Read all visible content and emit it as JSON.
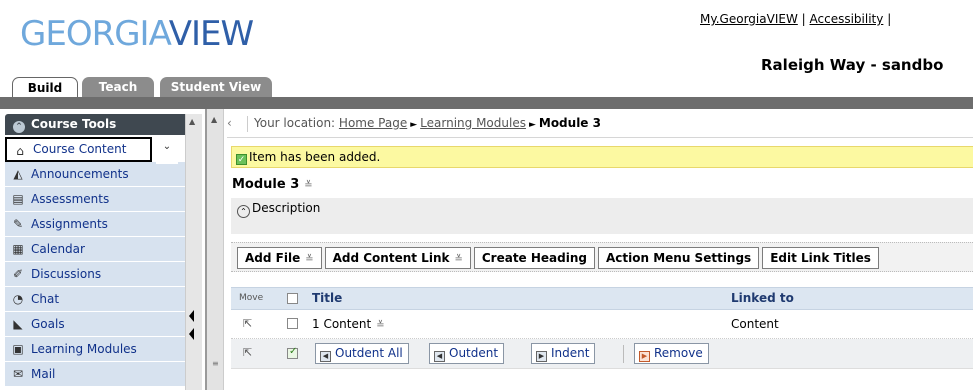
{
  "header": {
    "logo": {
      "part1": "GEORGIA",
      "part2": "VIEW"
    },
    "links": [
      "My.GeorgiaVIEW",
      "Accessibility"
    ],
    "link_separator": "|",
    "course_title": "Raleigh Way - sandbo",
    "tabs": [
      "Build",
      "Teach",
      "Student View"
    ]
  },
  "course_tools": {
    "title": "Course Tools",
    "items": [
      {
        "label": "Course Content",
        "icon": "house-icon",
        "active": true
      },
      {
        "label": "Announcements",
        "icon": "megaphone-icon"
      },
      {
        "label": "Assessments",
        "icon": "assessment-icon"
      },
      {
        "label": "Assignments",
        "icon": "assignment-icon"
      },
      {
        "label": "Calendar",
        "icon": "calendar-icon"
      },
      {
        "label": "Discussions",
        "icon": "discussion-icon"
      },
      {
        "label": "Chat",
        "icon": "chat-bubble-icon"
      },
      {
        "label": "Goals",
        "icon": "goals-icon"
      },
      {
        "label": "Learning Modules",
        "icon": "module-icon"
      },
      {
        "label": "Mail",
        "icon": "mail-icon"
      }
    ]
  },
  "breadcrumb": {
    "prefix": "Your location:",
    "items": [
      "Home Page",
      "Learning Modules"
    ],
    "current": "Module 3"
  },
  "notice": "Item has been added.",
  "module": {
    "title": "Module 3",
    "description_label": "Description"
  },
  "toolbar": {
    "buttons": [
      "Add File",
      "Add Content Link",
      "Create Heading",
      "Action Menu Settings",
      "Edit Link Titles"
    ]
  },
  "grid": {
    "columns": {
      "move": "Move",
      "title": "Title",
      "linked_to": "Linked to"
    },
    "rows": [
      {
        "title": "1 Content",
        "linked_to": "Content",
        "checked": false
      }
    ],
    "actions": [
      "Outdent All",
      "Outdent",
      "Indent",
      "Remove"
    ]
  },
  "colors": {
    "tool_bg": "#d7e2ef",
    "tool_text": "#10318a",
    "notice_bg": "#fcf9a1",
    "grid_header_bg": "#dce6f1",
    "tab_inactive": "#8c8c8c"
  }
}
